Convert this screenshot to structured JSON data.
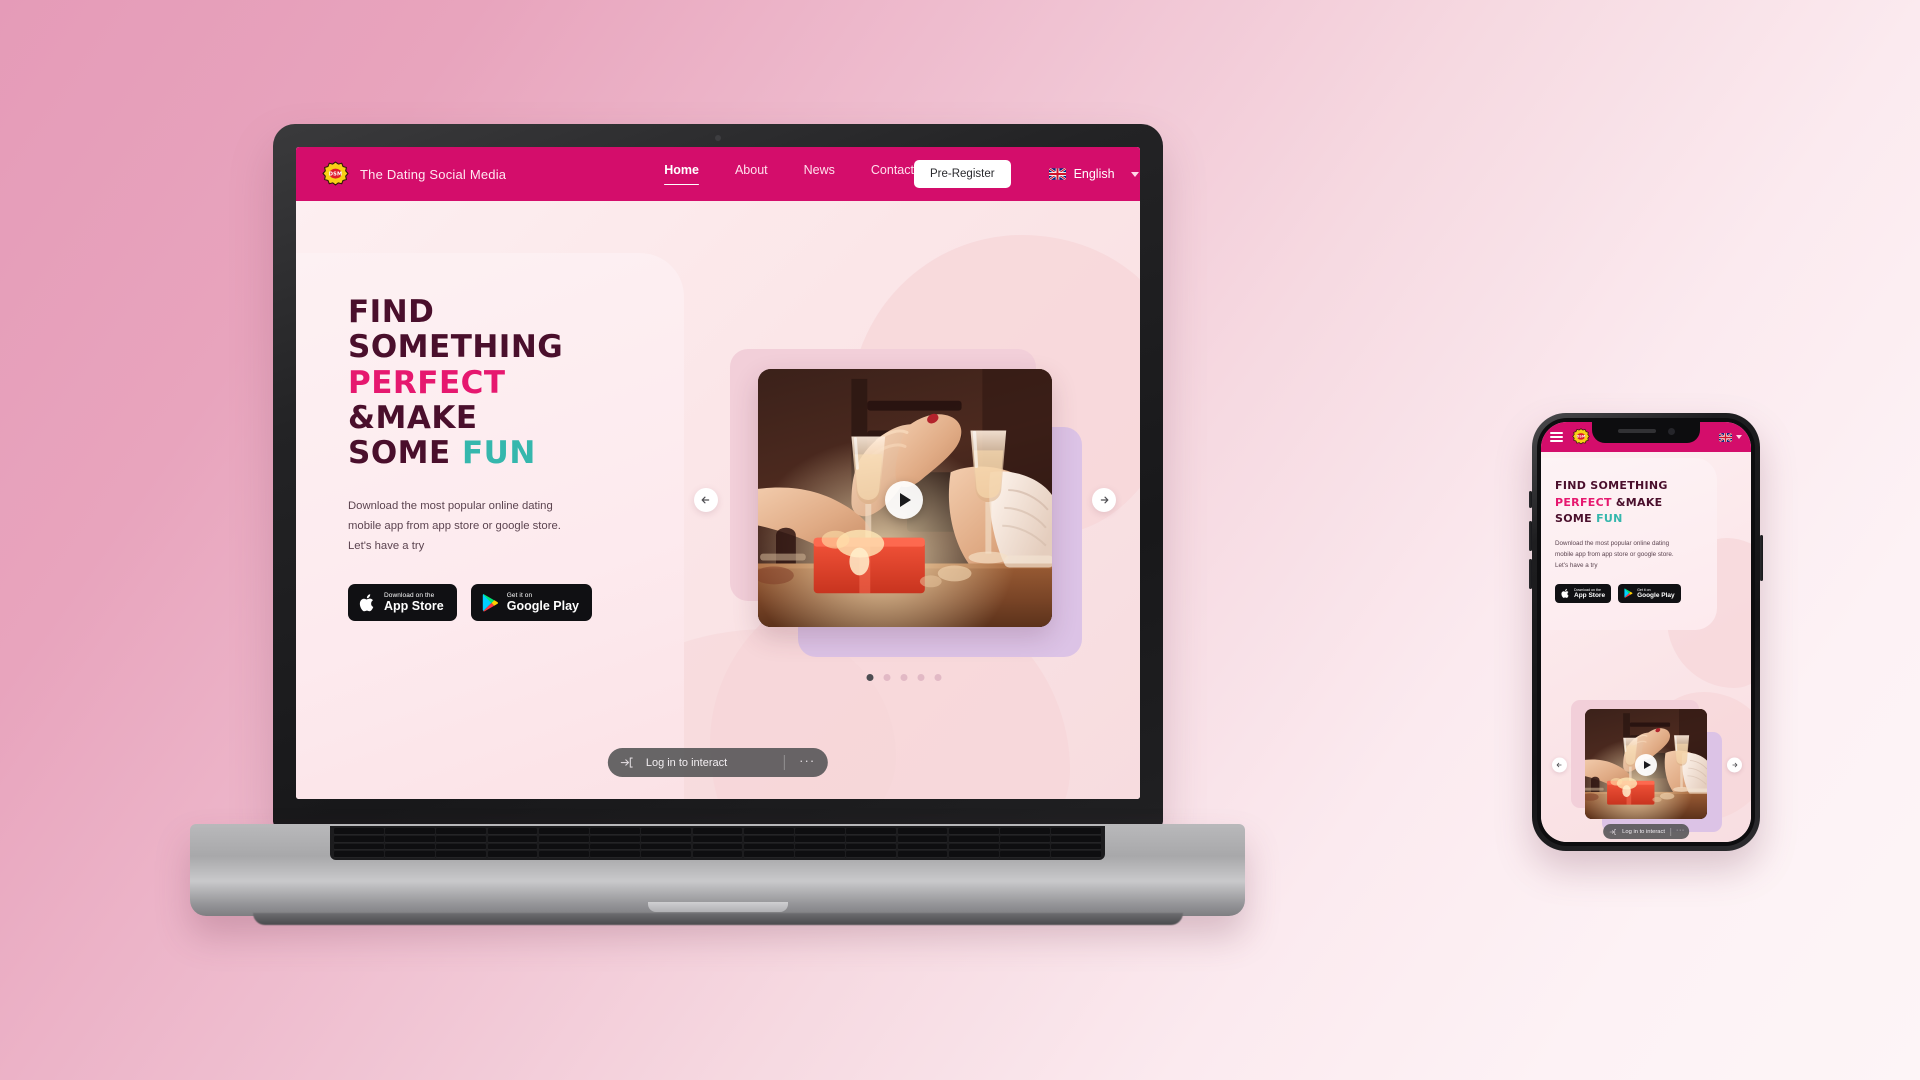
{
  "background": {
    "gradient_from": "#e59bb8",
    "gradient_to": "#fdf5f7"
  },
  "brand": {
    "name": "The Dating Social Media",
    "logo_text": "DSM",
    "accent_pink": "#d40d6b",
    "accent_magenta": "#e6186f",
    "accent_teal": "#35b7ad",
    "headline_dark": "#4a0f2c"
  },
  "navbar": {
    "links": [
      {
        "label": "Home",
        "active": true
      },
      {
        "label": "About",
        "active": false
      },
      {
        "label": "News",
        "active": false
      },
      {
        "label": "Contact",
        "active": false
      }
    ],
    "cta_label": "Pre-Register",
    "language": {
      "label": "English",
      "flag": "uk-flag-icon"
    }
  },
  "hero": {
    "headline_lines": [
      {
        "text": "FIND",
        "color": "dark"
      },
      {
        "text": "SOMETHING",
        "color": "dark"
      },
      {
        "text": "PERFECT",
        "color": "pink"
      },
      {
        "text": "&MAKE",
        "color": "dark"
      },
      {
        "text": "SOME FUN",
        "color": "mixed"
      }
    ],
    "headline_some": "SOME ",
    "headline_fun": "FUN",
    "paragraph": "Download the most popular online dating mobile app from app store or google store. Let's have a try",
    "store_buttons": [
      {
        "icon": "apple-icon",
        "small": "Download on the",
        "big": "App Store"
      },
      {
        "icon": "google-play-icon",
        "small": "Get it on",
        "big": "Google Play"
      }
    ]
  },
  "carousel": {
    "prev_label": "Previous slide",
    "next_label": "Next slide",
    "play_label": "Play video",
    "dots": [
      {
        "active": true
      },
      {
        "active": false
      },
      {
        "active": false
      },
      {
        "active": false
      },
      {
        "active": false
      }
    ],
    "video_alt": "Couple holding hands over champagne glasses at a candlelit dinner with a red gift box"
  },
  "login_bar": {
    "icon": "login-arrow-icon",
    "label": "Log in to interact",
    "more": "···"
  },
  "phone": {
    "menu_icon": "hamburger-menu-icon",
    "headline_lines": [
      {
        "text": "FIND SOMETHING",
        "color": "dark"
      },
      {
        "text": "PERFECT &MAKE",
        "color": "pink-dark"
      },
      {
        "text": "SOME FUN",
        "color": "dark-teal"
      }
    ],
    "hl_perfect": "PERFECT ",
    "hl_make": "&MAKE",
    "hl_some": "SOME ",
    "hl_fun": "FUN",
    "paragraph": "Download the most popular online dating mobile app from app store or google store. Let's have a try",
    "store_buttons": [
      {
        "small": "Download on the",
        "big": "App Store"
      },
      {
        "small": "Get it on",
        "big": "Google Play"
      }
    ],
    "login_label": "Log in to interact",
    "login_more": "···"
  }
}
